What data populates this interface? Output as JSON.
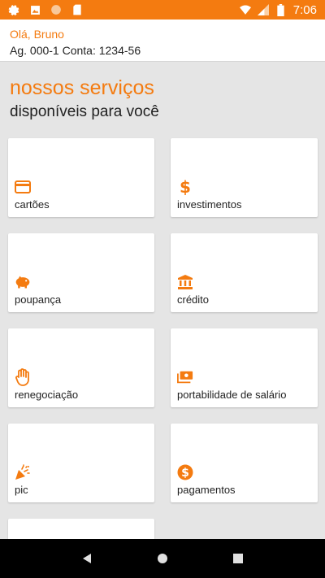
{
  "status_bar": {
    "time": "7:06",
    "icons": [
      "gear-icon",
      "photo-icon",
      "circle-icon",
      "sd-card-icon",
      "wifi-icon",
      "signal-icon",
      "battery-icon"
    ],
    "color": "#f47b10"
  },
  "header": {
    "greeting": "Olá, Bruno",
    "account": "Ag. 000-1 Conta: 1234-56"
  },
  "main": {
    "title": "nossos serviços",
    "subtitle": "disponíveis para você",
    "services": [
      {
        "label": "cartões",
        "icon": "credit-card-icon"
      },
      {
        "label": "investimentos",
        "icon": "dollar-sign-icon"
      },
      {
        "label": "poupança",
        "icon": "piggy-bank-icon"
      },
      {
        "label": "crédito",
        "icon": "bank-icon"
      },
      {
        "label": "renegociação",
        "icon": "hand-icon"
      },
      {
        "label": "portabilidade de salário",
        "icon": "money-transfer-icon"
      },
      {
        "label": "pic",
        "icon": "party-popper-icon"
      },
      {
        "label": "pagamentos",
        "icon": "dollar-circle-icon"
      },
      {
        "label": "",
        "icon": ""
      }
    ]
  },
  "nav_bar": {
    "buttons": [
      "back-icon",
      "home-icon",
      "recents-icon"
    ]
  },
  "colors": {
    "accent": "#f47b10",
    "background": "#e5e5e5",
    "card": "#ffffff"
  }
}
